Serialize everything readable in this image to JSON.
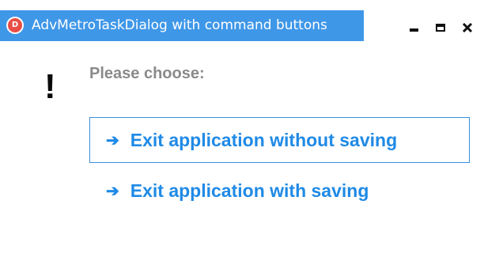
{
  "window": {
    "title": "AdvMetroTaskDialog with command buttons",
    "app_icon_letter": "D",
    "accent_color": "#3f97e8"
  },
  "caption": {
    "minimize_icon": "minimize-icon",
    "maximize_icon": "maximize-icon",
    "close_icon": "close-icon",
    "close_glyph": "✕"
  },
  "content": {
    "icon": "exclamation-icon",
    "icon_glyph": "!",
    "prompt": "Please choose:",
    "command_buttons": [
      {
        "arrow": "➔",
        "label": "Exit application without saving"
      },
      {
        "arrow": "➔",
        "label": "Exit application with saving"
      }
    ]
  }
}
